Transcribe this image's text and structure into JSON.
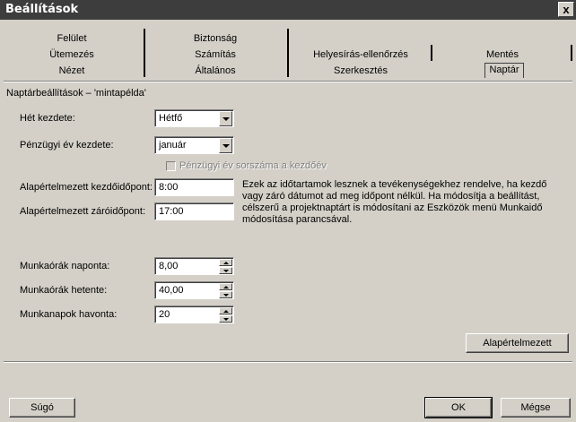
{
  "window": {
    "title": "Beállítások",
    "close_label": "x"
  },
  "tabs": {
    "row1": [
      "Felület",
      "Biztonság"
    ],
    "row2": [
      "Ütemezés",
      "Számítás",
      "Helyesírás-ellenőrzés",
      "Mentés"
    ],
    "row3": [
      "Nézet",
      "Általános",
      "Szerkesztés",
      "Naptár"
    ],
    "active": "Naptár"
  },
  "section": {
    "title": "Naptárbeállítások – 'mintapélda'"
  },
  "week_start": {
    "label": "Hét kezdete:",
    "value": "Hétfő"
  },
  "fiscal_year": {
    "label": "Pénzügyi év kezdete:",
    "value": "január"
  },
  "fiscal_numbering": {
    "label": "Pénzügyi év sorszáma a kezdőév"
  },
  "default_start": {
    "label": "Alapértelmezett kezdőidőpont:",
    "value": "8:00"
  },
  "default_end": {
    "label": "Alapértelmezett záróidőpont:",
    "value": "17:00"
  },
  "info_text": [
    "Ezek az időtartamok lesznek a tevékenységekhez rendelve, ha kezdő",
    "vagy záró dátumot ad meg időpont nélkül. Ha módosítja a beállítást,",
    "célszerű a projektnaptárt is módosítani az Eszközök menü Munkaidő",
    "módosítása parancsával."
  ],
  "hours_per_day": {
    "label": "Munkaórák naponta:",
    "value": "8,00"
  },
  "hours_per_week": {
    "label": "Munkaórák hetente:",
    "value": "40,00"
  },
  "days_per_month": {
    "label": "Munkanapok havonta:",
    "value": "20"
  },
  "buttons": {
    "default": "Alapértelmezett",
    "help": "Súgó",
    "ok": "OK",
    "cancel": "Mégse"
  }
}
